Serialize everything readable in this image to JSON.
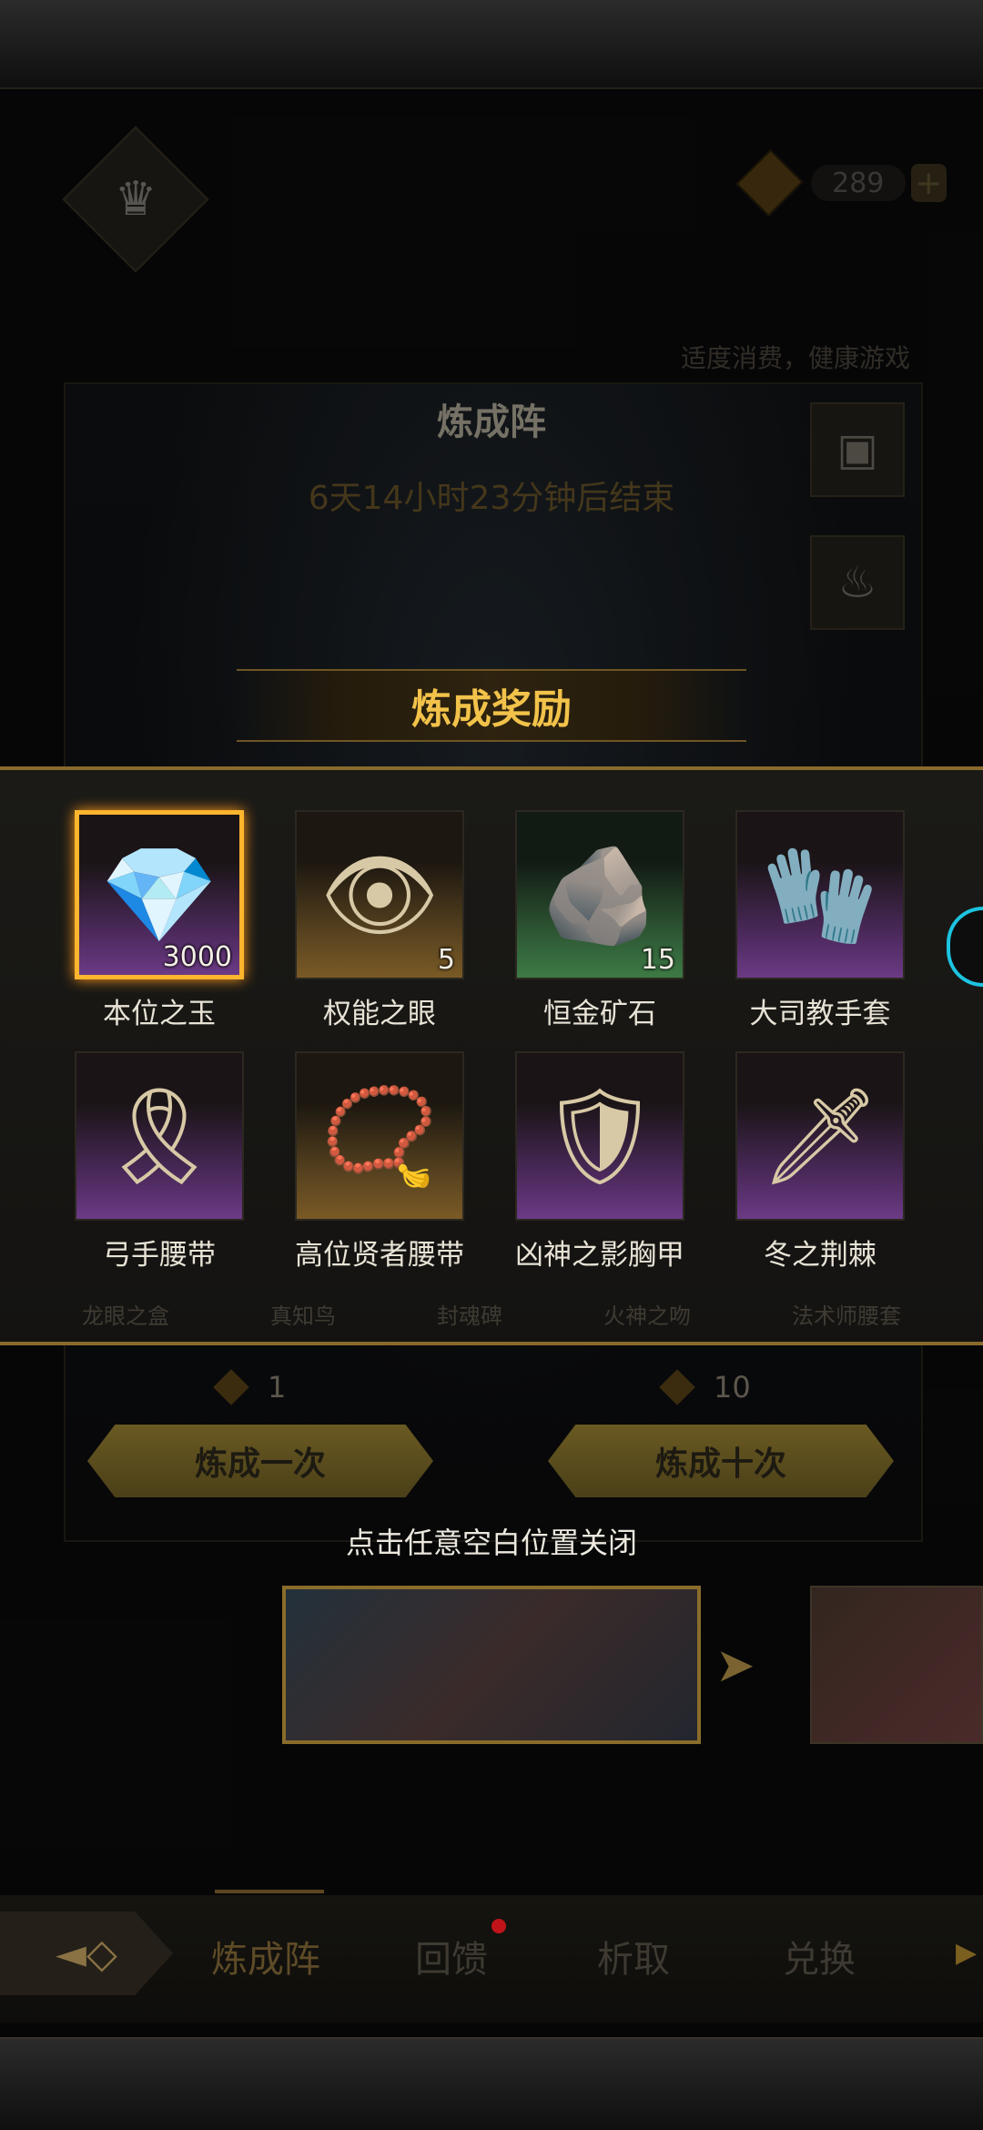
{
  "header": {
    "title": "炼成阵",
    "countdown": "6天14小时23分钟后结束",
    "advice": "适度消费，健康游戏",
    "currency_value": "289",
    "currency_plus": "+"
  },
  "icons": {
    "crown": "♛",
    "chest": "▣",
    "brazier": "♨",
    "back": "◄◇",
    "next_arrow": "➤",
    "more": "▶"
  },
  "reward": {
    "title": "炼成奖励",
    "items": [
      {
        "name": "本位之玉",
        "qty": "3000",
        "art": "💎",
        "rarity": "purple",
        "selected": true
      },
      {
        "name": "权能之眼",
        "qty": "5",
        "art": "👁",
        "rarity": "gold",
        "selected": false
      },
      {
        "name": "恒金矿石",
        "qty": "15",
        "art": "🪨",
        "rarity": "green",
        "selected": false
      },
      {
        "name": "大司教手套",
        "qty": "",
        "art": "🧤",
        "rarity": "purple",
        "selected": false
      },
      {
        "name": "弓手腰带",
        "qty": "",
        "art": "🎗",
        "rarity": "purple",
        "selected": false
      },
      {
        "name": "高位贤者腰带",
        "qty": "",
        "art": "📿",
        "rarity": "gold",
        "selected": false
      },
      {
        "name": "凶神之影胸甲",
        "qty": "",
        "art": "🛡",
        "rarity": "purple",
        "selected": false
      },
      {
        "name": "冬之荆棘",
        "qty": "",
        "art": "🗡",
        "rarity": "purple",
        "selected": false
      }
    ]
  },
  "faded_tabs": [
    "龙眼之盒",
    "真知鸟",
    "封魂碑",
    "火神之吻",
    "法术师腰套"
  ],
  "actions": {
    "once_cost": "1",
    "ten_cost": "10",
    "once_label": "炼成一次",
    "ten_label": "炼成十次",
    "close_hint": "点击任意空白位置关闭"
  },
  "nav": {
    "tabs": [
      "炼成阵",
      "回馈",
      "析取",
      "兑换"
    ],
    "active": "炼成阵"
  },
  "colors": {
    "accent_gold": "#f2c24a",
    "highlight_border": "#ffb52d",
    "notification_dot": "#c0141a",
    "edge_indicator": "#1cc4e0"
  }
}
